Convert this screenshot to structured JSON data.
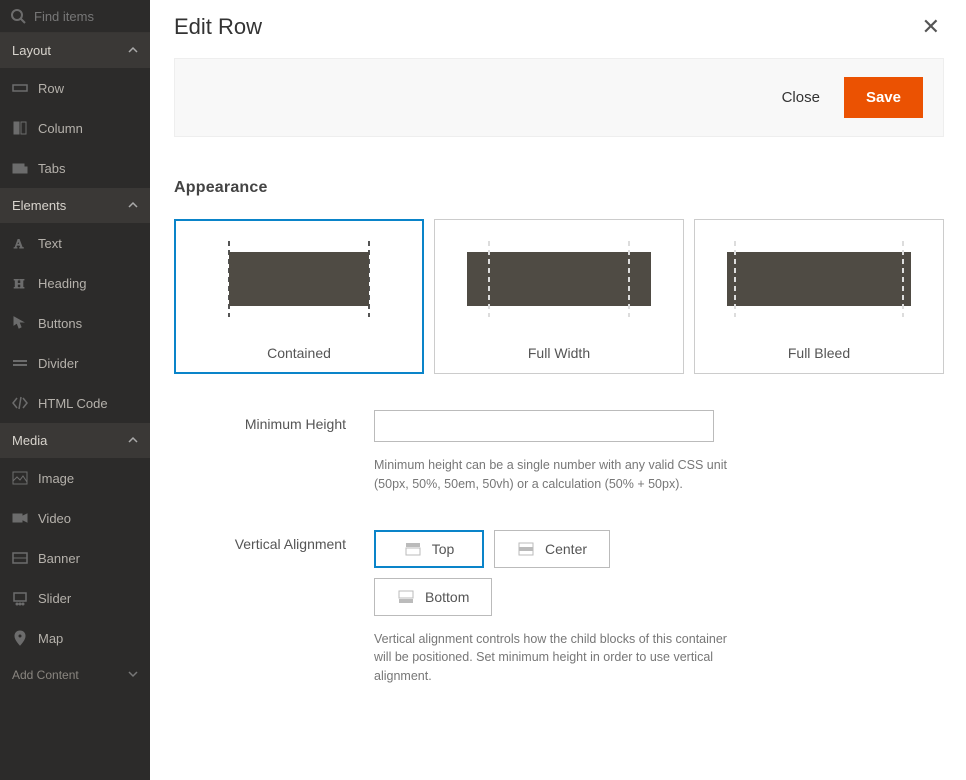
{
  "search": {
    "placeholder": "Find items"
  },
  "sidebar": {
    "sections": [
      {
        "label": "Layout",
        "items": [
          "Row",
          "Column",
          "Tabs"
        ]
      },
      {
        "label": "Elements",
        "items": [
          "Text",
          "Heading",
          "Buttons",
          "Divider",
          "HTML Code"
        ]
      },
      {
        "label": "Media",
        "items": [
          "Image",
          "Video",
          "Banner",
          "Slider",
          "Map"
        ]
      }
    ],
    "add_content": "Add Content"
  },
  "header": {
    "title": "Edit Row"
  },
  "actions": {
    "close": "Close",
    "save": "Save"
  },
  "appearance": {
    "title": "Appearance",
    "options": [
      "Contained",
      "Full Width",
      "Full Bleed"
    ],
    "selected": 0
  },
  "min_height": {
    "label": "Minimum Height",
    "value": "",
    "help": "Minimum height can be a single number with any valid CSS unit (50px, 50%, 50em, 50vh) or a calculation (50% + 50px)."
  },
  "valign": {
    "label": "Vertical Alignment",
    "options": [
      "Top",
      "Center",
      "Bottom"
    ],
    "selected": 0,
    "help": "Vertical alignment controls how the child blocks of this container will be positioned. Set minimum height in order to use vertical alignment."
  }
}
